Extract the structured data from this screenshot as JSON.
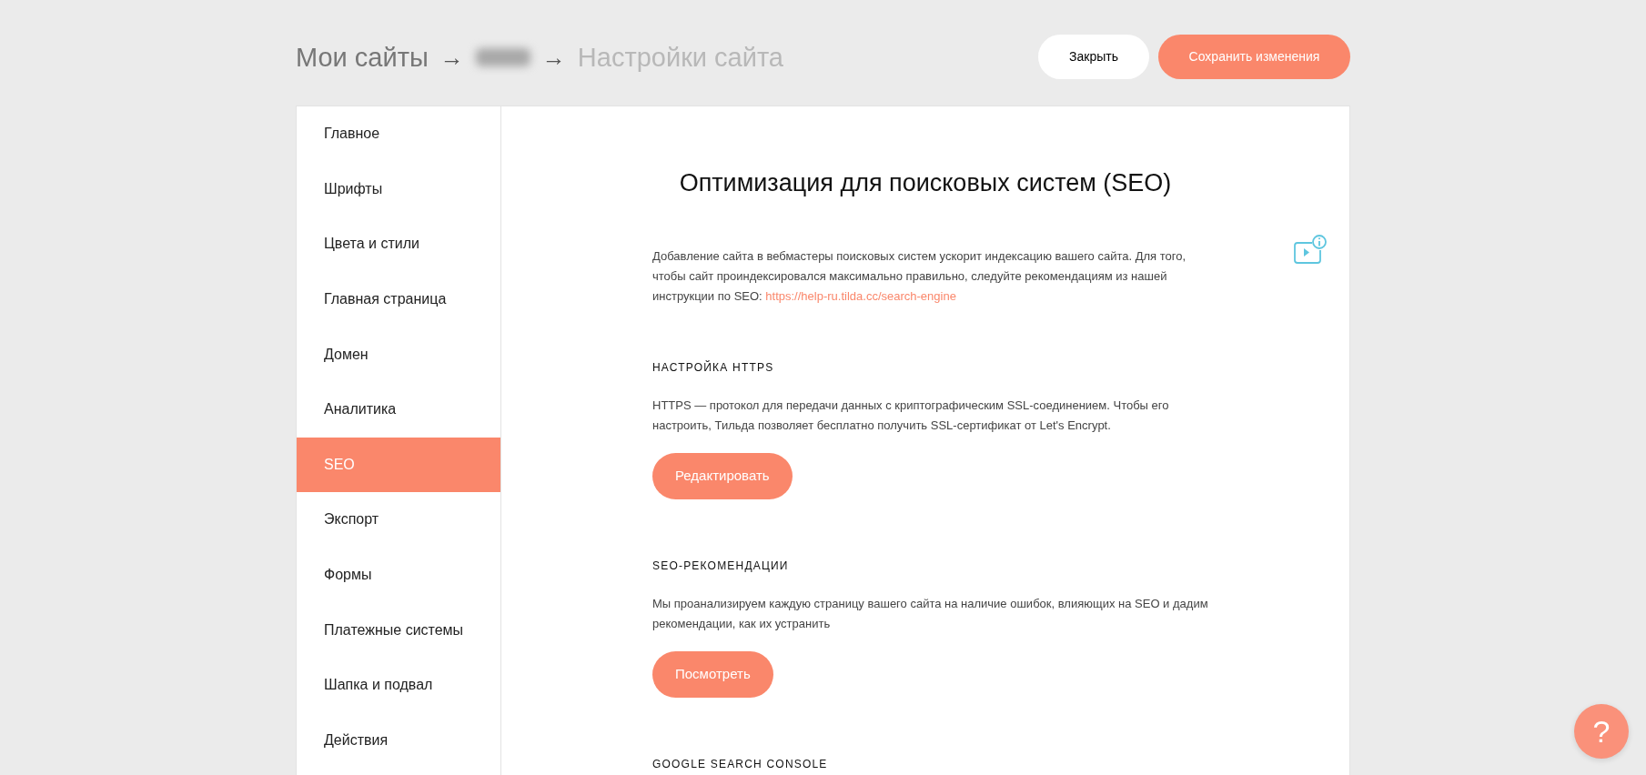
{
  "breadcrumb": [
    {
      "kind": "link",
      "label": "Мои сайты"
    },
    {
      "kind": "separator",
      "label": "→"
    },
    {
      "kind": "redacted"
    },
    {
      "kind": "separator",
      "label": "→"
    },
    {
      "kind": "current",
      "label": "Настройки сайта"
    }
  ],
  "header_buttons": [
    {
      "kind": "secondary",
      "label": "Закрыть"
    },
    {
      "kind": "primary",
      "label": "Сохранить изменения"
    }
  ],
  "sidebar": {
    "items": [
      {
        "label": "Главное",
        "selected": false
      },
      {
        "label": "Шрифты",
        "selected": false
      },
      {
        "label": "Цвета и стили",
        "selected": false
      },
      {
        "label": "Главная страница",
        "selected": false
      },
      {
        "label": "Домен",
        "selected": false
      },
      {
        "label": "Аналитика",
        "selected": false
      },
      {
        "label": "SEO",
        "selected": true
      },
      {
        "label": "Экспорт",
        "selected": false
      },
      {
        "label": "Формы",
        "selected": false
      },
      {
        "label": "Платежные системы",
        "selected": false
      },
      {
        "label": "Шапка и подвал",
        "selected": false
      },
      {
        "label": "Действия",
        "selected": false
      }
    ]
  },
  "content": {
    "title": "Оптимизация для поисковых систем (SEO)",
    "intro": {
      "text": "Добавление сайта в вебмастеры поисковых систем ускорит индексацию вашего сайта. Для того, чтобы сайт проиндексировался максимально правильно, следуйте рекомендациям из нашей инструкции по SEO:",
      "link": "https://help-ru.tilda.cc/search-engine"
    },
    "sections": [
      {
        "heading": "НАСТРОЙКА HTTPS",
        "text": "HTTPS — протокол для передачи данных с криптографическим SSL-соединением. Чтобы его настроить, Тильда позволяет бесплатно получить SSL-сертификат от Let's Encrypt.",
        "button": "Редактировать"
      },
      {
        "heading": "SEO-РЕКОМЕНДАЦИИ",
        "text": "Мы проанализируем каждую страницу вашего сайта на наличие ошибок, влияющих на SEO и дадим рекомендации, как их устранить",
        "button": "Посмотреть"
      },
      {
        "heading": "GOOGLE SEARCH CONSOLE"
      }
    ]
  },
  "help_button": {
    "label": "?"
  }
}
